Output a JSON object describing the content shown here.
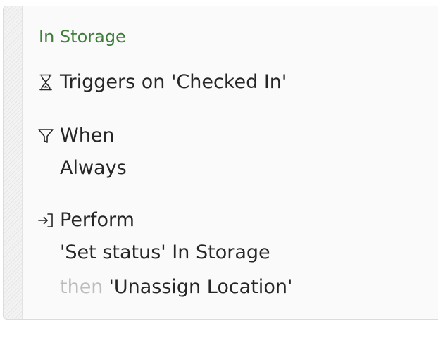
{
  "card": {
    "title": "In Storage",
    "trigger": {
      "icon": "hourglass-icon",
      "label": "Triggers on 'Checked In'"
    },
    "condition": {
      "icon": "filter-icon",
      "heading": "When",
      "value": "Always"
    },
    "action": {
      "icon": "sign-in-icon",
      "heading": "Perform",
      "steps": [
        {
          "text": "'Set status' In Storage"
        },
        {
          "connector": "then",
          "text": "'Unassign Location'"
        }
      ]
    }
  },
  "colors": {
    "title": "#3f7d3a",
    "text": "#262626",
    "connector": "#bdbdbd",
    "card_bg": "#fafafa",
    "border": "#dcdcdc"
  }
}
